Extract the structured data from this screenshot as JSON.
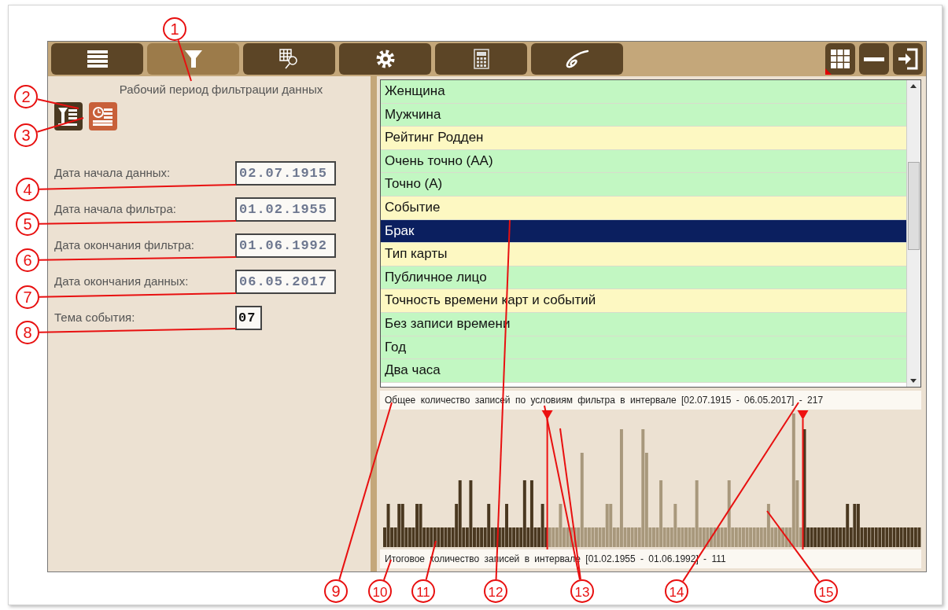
{
  "toolbar": {
    "tabs": [
      {
        "kind": "list",
        "selected": false
      },
      {
        "kind": "filter",
        "selected": true
      },
      {
        "kind": "grid-search",
        "selected": false
      },
      {
        "kind": "settings",
        "selected": false
      },
      {
        "kind": "calculator",
        "selected": false
      },
      {
        "kind": "script",
        "selected": false
      }
    ],
    "window_buttons": [
      {
        "kind": "grid"
      },
      {
        "kind": "minimize"
      },
      {
        "kind": "exit"
      }
    ]
  },
  "filter_panel": {
    "title": "Рабочий период фильтрации данных",
    "mode_buttons": [
      {
        "kind": "filter-list",
        "selected": false
      },
      {
        "kind": "clock-list",
        "selected": true
      }
    ],
    "fields": [
      {
        "label": "Дата начала данных:",
        "value": "02.07.1915",
        "kind": "date"
      },
      {
        "label": "Дата начала фильтра:",
        "value": "01.02.1955",
        "kind": "date"
      },
      {
        "label": "Дата окончания фильтра:",
        "value": "01.06.1992",
        "kind": "date"
      },
      {
        "label": "Дата окончания данных:",
        "value": "06.05.2017",
        "kind": "date"
      },
      {
        "label": "Тема события:",
        "value": "07",
        "kind": "code"
      }
    ]
  },
  "criteria_list": {
    "items": [
      {
        "label": "Женщина",
        "color": "#c2f7c2",
        "selected": false
      },
      {
        "label": "Мужчина",
        "color": "#c2f7c2",
        "selected": false
      },
      {
        "label": "Рейтинг Родден",
        "color": "#fdf8c2",
        "selected": false
      },
      {
        "label": "Очень точно (АА)",
        "color": "#c2f7c2",
        "selected": false
      },
      {
        "label": "Точно (А)",
        "color": "#c2f7c2",
        "selected": false
      },
      {
        "label": "Событие",
        "color": "#fdf8c2",
        "selected": false
      },
      {
        "label": "Брак",
        "color": "#0b1f5f",
        "selected": true
      },
      {
        "label": "Тип карты",
        "color": "#fdf8c2",
        "selected": false
      },
      {
        "label": "Публичное лицо",
        "color": "#c2f7c2",
        "selected": false
      },
      {
        "label": "Точность времени карт и событий",
        "color": "#fdf8c2",
        "selected": false
      },
      {
        "label": "Без записи времени",
        "color": "#c2f7c2",
        "selected": false
      },
      {
        "label": "Год",
        "color": "#c2f7c2",
        "selected": false
      },
      {
        "label": "Два часа",
        "color": "#c2f7c2",
        "selected": false
      }
    ]
  },
  "histogram": {
    "total_caption": "Общее количество записей по условиям фильтра в интервале [02.07.1915 - 06.05.2017] - 217",
    "result_caption": "Итоговое количество записей в интервале [01.02.1955 - 01.06.1992] - 111"
  },
  "callouts": [
    {
      "label": "1"
    },
    {
      "label": "2"
    },
    {
      "label": "3"
    },
    {
      "label": "4"
    },
    {
      "label": "5"
    },
    {
      "label": "6"
    },
    {
      "label": "7"
    },
    {
      "label": "8"
    },
    {
      "label": "9"
    },
    {
      "label": "10"
    },
    {
      "label": "11"
    },
    {
      "label": "12"
    },
    {
      "label": "13"
    },
    {
      "label": "14"
    },
    {
      "label": "15"
    }
  ]
}
